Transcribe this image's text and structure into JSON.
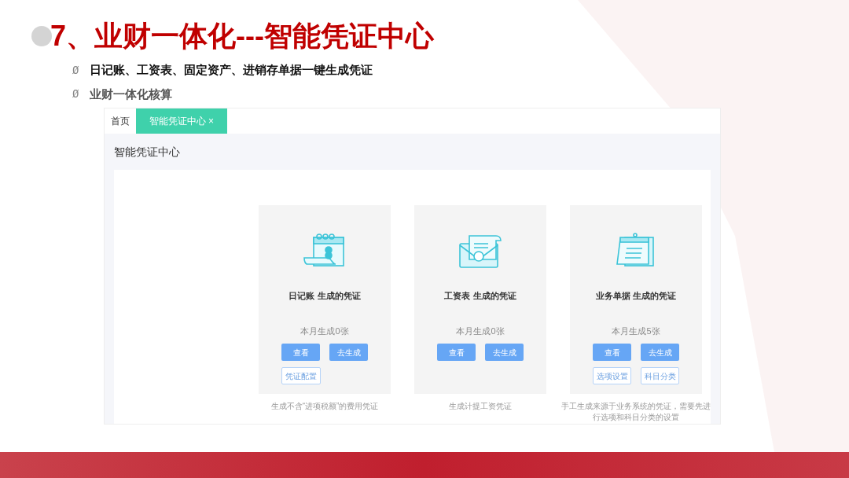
{
  "slide_title": "7、业财一体化---智能凭证中心",
  "bullets": [
    {
      "marker": "Ø",
      "text": "日记账、工资表、固定资产、进销存单据一键生成凭证",
      "emphasis": true
    },
    {
      "marker": "Ø",
      "text": "业财一体化核算",
      "emphasis": false
    }
  ],
  "app": {
    "tabs": [
      {
        "label": "首页",
        "selected": false
      },
      {
        "label": "智能凭证中心",
        "selected": true,
        "close": "×"
      }
    ],
    "page_title": "智能凭证中心",
    "cards": [
      {
        "kind": "calendar",
        "title": "日记账 生成的凭证",
        "count": "本月生成0张",
        "primary_buttons": [
          "查看",
          "去生成"
        ],
        "secondary_buttons": [
          "凭证配置"
        ],
        "description": "生成不含“进项税额”的费用凭证"
      },
      {
        "kind": "envelope",
        "title": "工资表 生成的凭证",
        "count": "本月生成0张",
        "primary_buttons": [
          "查看",
          "去生成"
        ],
        "description": "生成计提工资凭证"
      },
      {
        "kind": "document",
        "title": "业务单据 生成的凭证",
        "count": "本月生成5张",
        "primary_buttons": [
          "查看",
          "去生成"
        ],
        "secondary_buttons": [
          "选项设置",
          "科目分类"
        ],
        "description": "手工生成来源于业务系统的凭证，需要先进行选项和科目分类的设置"
      }
    ]
  }
}
